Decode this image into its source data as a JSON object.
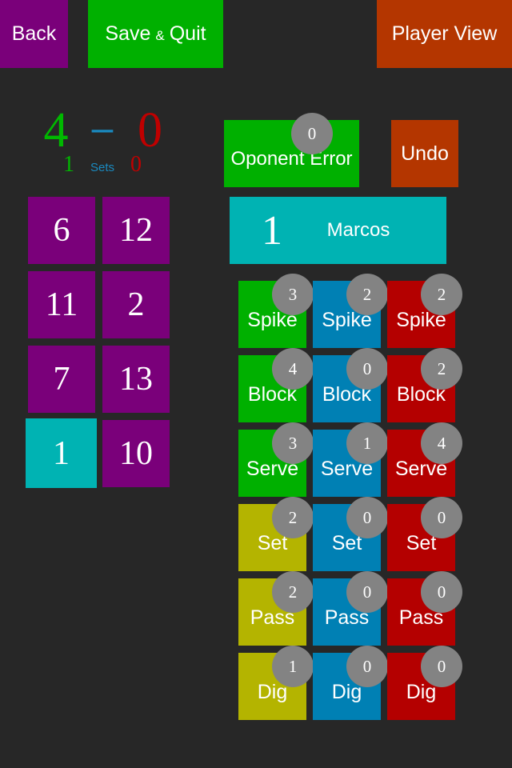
{
  "toolbar": {
    "back_label": "Back",
    "save_label": "Save",
    "save_amp": "&",
    "quit_label": "Quit",
    "player_view_label": "Player View"
  },
  "score": {
    "home": "4",
    "separator": "–",
    "away": "0",
    "sets_home": "1",
    "sets_label": "Sets",
    "sets_away": "0"
  },
  "roster": [
    {
      "number": "6",
      "active": false
    },
    {
      "number": "12",
      "active": false
    },
    {
      "number": "11",
      "active": false
    },
    {
      "number": "2",
      "active": false
    },
    {
      "number": "7",
      "active": false
    },
    {
      "number": "13",
      "active": false
    },
    {
      "number": "1",
      "active": true
    },
    {
      "number": "10",
      "active": false
    }
  ],
  "opponent_error": {
    "label": "Oponent Error",
    "count": "0"
  },
  "undo_label": "Undo",
  "current_player": {
    "number": "1",
    "name": "Marcos"
  },
  "colors": {
    "positive": "#00b000",
    "neutral": "#0080b4",
    "negative": "#b40000",
    "attempt": "#b4b400",
    "badge": "#838383",
    "player": "#7a007a",
    "active_player": "#00b3b3",
    "accent_orange": "#b43600"
  },
  "stats": [
    {
      "label": "Spike",
      "counts": [
        "3",
        "2",
        "2"
      ],
      "colors": [
        "positive",
        "neutral",
        "negative"
      ]
    },
    {
      "label": "Block",
      "counts": [
        "4",
        "0",
        "2"
      ],
      "colors": [
        "positive",
        "neutral",
        "negative"
      ]
    },
    {
      "label": "Serve",
      "counts": [
        "3",
        "1",
        "4"
      ],
      "colors": [
        "positive",
        "neutral",
        "negative"
      ]
    },
    {
      "label": "Set",
      "counts": [
        "2",
        "0",
        "0"
      ],
      "colors": [
        "attempt",
        "neutral",
        "negative"
      ]
    },
    {
      "label": "Pass",
      "counts": [
        "2",
        "0",
        "0"
      ],
      "colors": [
        "attempt",
        "neutral",
        "negative"
      ]
    },
    {
      "label": "Dig",
      "counts": [
        "1",
        "0",
        "0"
      ],
      "colors": [
        "attempt",
        "neutral",
        "negative"
      ]
    }
  ]
}
